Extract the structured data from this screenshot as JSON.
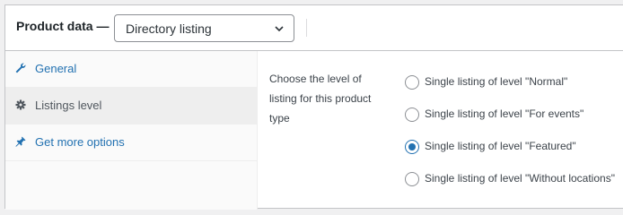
{
  "header": {
    "title": "Product data —",
    "product_type": "Directory listing"
  },
  "tabs": [
    {
      "label": "General",
      "icon": "wrench-icon"
    },
    {
      "label": "Listings level",
      "icon": "gear-icon"
    },
    {
      "label": "Get more options",
      "icon": "pushpin-icon"
    }
  ],
  "active_tab": "Listings level",
  "listings_level": {
    "label": "Choose the level of listing for this product type",
    "options": [
      {
        "label": "Single listing of level \"Normal\"",
        "checked": false
      },
      {
        "label": "Single listing of level \"For events\"",
        "checked": false
      },
      {
        "label": "Single listing of level \"Featured\"",
        "checked": true
      },
      {
        "label": "Single listing of level \"Without locations\"",
        "checked": false
      }
    ]
  },
  "colors": {
    "link": "#2271b1",
    "border": "#c3c4c7",
    "active_tab_bg": "#eeeeee"
  }
}
